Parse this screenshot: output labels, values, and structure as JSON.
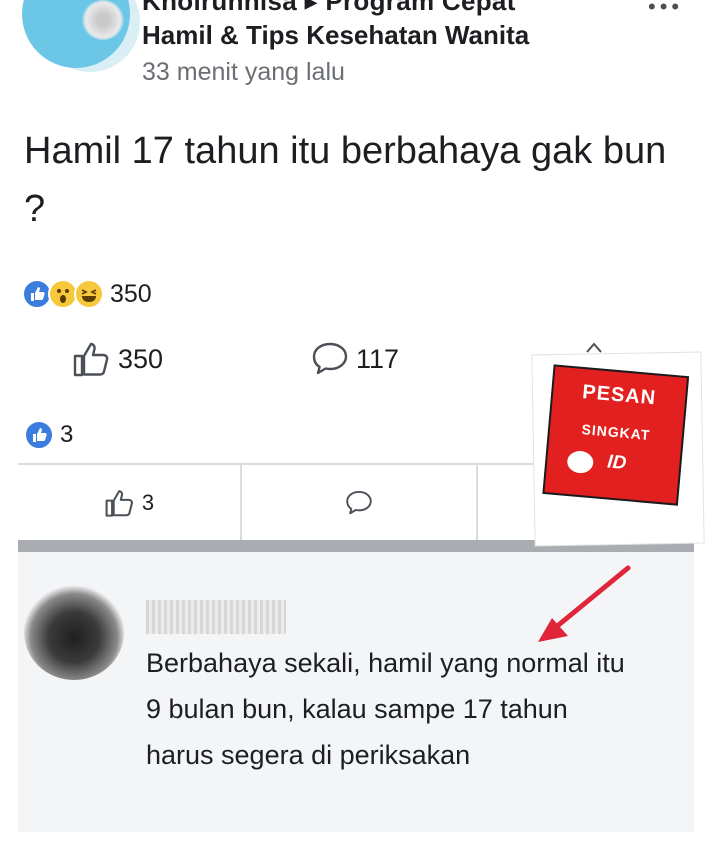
{
  "post": {
    "header_line1": "Kholrunnisa ▸ Program Cepat",
    "header_line2": "Hamil & Tips Kesehatan Wanita",
    "timestamp": "33 menit yang lalu",
    "text": "Hamil 17 tahun itu berbahaya gak bun ?",
    "reaction_count": "350",
    "reaction_icons": [
      "like-icon",
      "wow-icon",
      "haha-icon"
    ],
    "like_count": "350",
    "comment_count": "117",
    "sub_reaction_count": "3",
    "sub_like_count": "3"
  },
  "badge": {
    "line1": "PESAN",
    "line2": "SINGKAT",
    "line3": "ID"
  },
  "comment": {
    "text": "Berbahaya sekali, hamil yang normal itu 9 bulan bun, kalau sampe 17 tahun harus segera di periksakan"
  },
  "colors": {
    "accent_blue": "#3b7ddd",
    "badge_red": "#e1201f",
    "arrow_red": "#e0243a"
  }
}
